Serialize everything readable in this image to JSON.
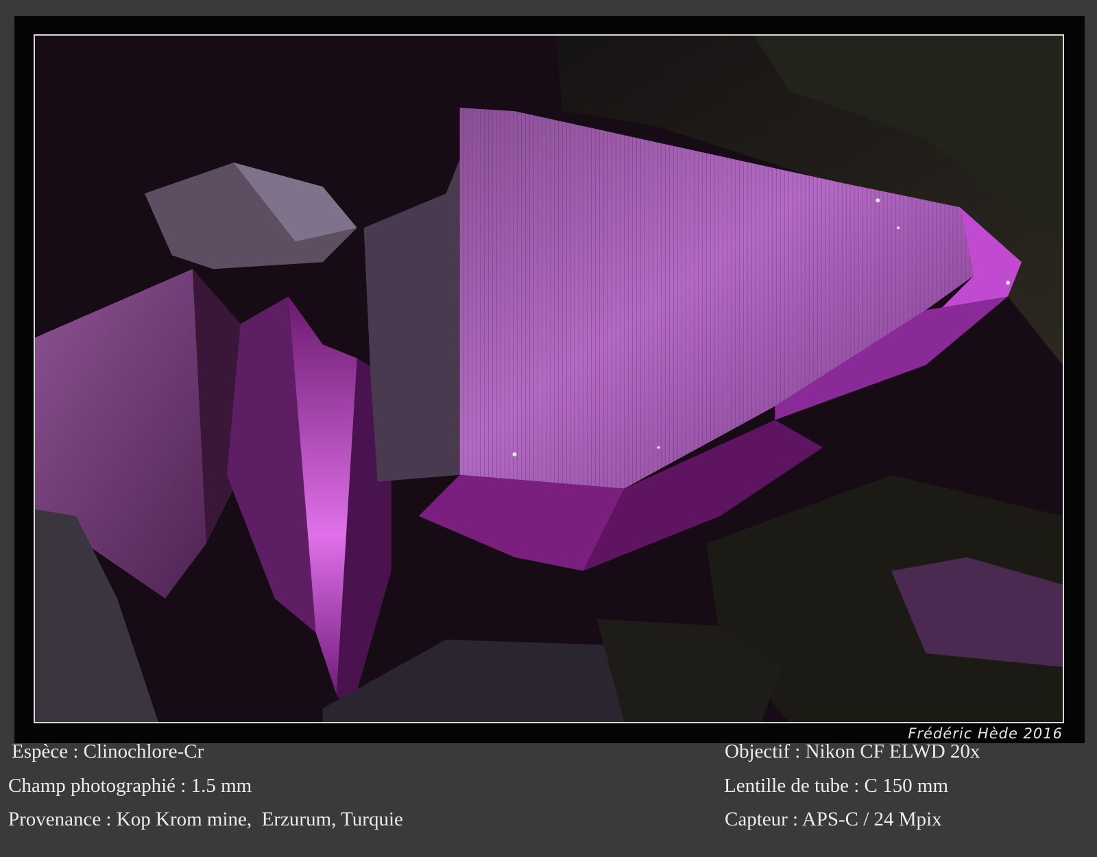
{
  "signature": "Frédéric Hède 2016",
  "captions": {
    "left": [
      "Espèce : Clinochlore-Cr",
      "Champ photographié : 1.5 mm",
      "Provenance : Kop Krom mine,  Erzurum, Turquie"
    ],
    "right": [
      "Objectif : Nikon CF ELWD 20x",
      "Lentille de tube : C 150 mm",
      "Capteur : APS-C / 24 Mpix"
    ]
  },
  "colors": {
    "background": "#3a3a3a",
    "frame": "#050505",
    "crystal_magenta": "#b04fc0",
    "crystal_dark": "#2a0f28"
  }
}
